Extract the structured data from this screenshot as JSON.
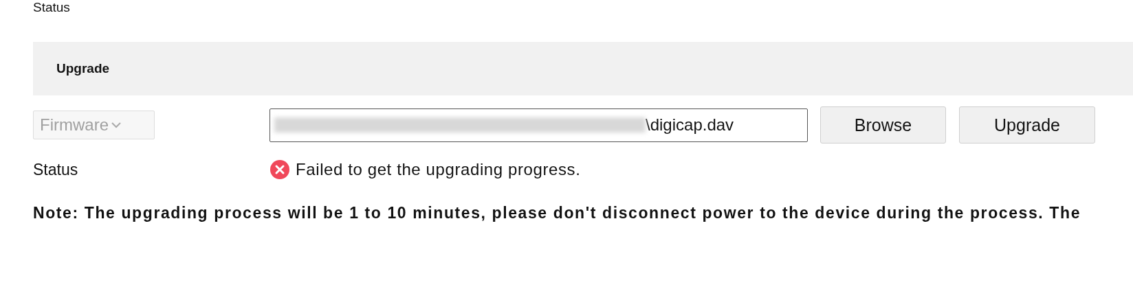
{
  "previous_section": {
    "label": "Status"
  },
  "section": {
    "title": "Upgrade"
  },
  "upgrade_form": {
    "type_select": {
      "value": "Firmware",
      "disabled": true
    },
    "file_field": {
      "redacted": true,
      "value": "\\digicap.dav"
    },
    "buttons": [
      "Browse",
      "Upgrade"
    ],
    "status": {
      "label": "Status",
      "kind": "error",
      "message": "Failed to get the upgrading progress."
    }
  },
  "note": "Note: The upgrading process will be 1 to 10 minutes, please don't disconnect power to the device during the process. The"
}
